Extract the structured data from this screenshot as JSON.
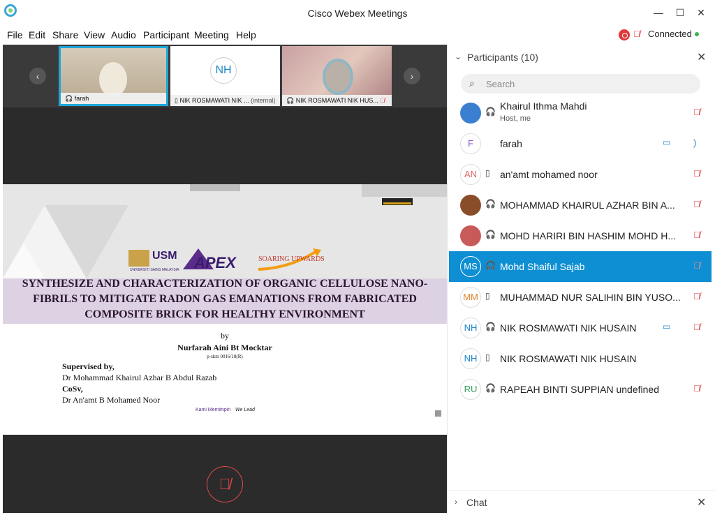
{
  "window": {
    "title": "Cisco Webex Meetings",
    "minimize": "—",
    "maximize": "☐",
    "close": "✕"
  },
  "menu": [
    "File",
    "Edit",
    "Share",
    "View",
    "Audio",
    "Participant",
    "Meeting",
    "Help"
  ],
  "status": {
    "connected": "Connected",
    "recording_icon": "record-icon"
  },
  "filmstrip": {
    "prev": "‹",
    "next": "›",
    "tiles": [
      {
        "label": "farah"
      },
      {
        "initials": "NH",
        "label": "NIK ROSMAWATI NIK ...",
        "suffix": "(internal)"
      },
      {
        "label": "NIK ROSMAWATI NIK HUS..."
      }
    ]
  },
  "slide": {
    "title_line1": "SYNTHESIZE AND CHARACTERIZATION OF ORGANIC CELLULOSE NANO-",
    "title_line2": "FIBRILS TO MITIGATE RADON GAS EMANATIONS FROM FABRICATED",
    "title_line3": "COMPOSITE BRICK FOR HEALTHY ENVIRONMENT",
    "by": "by",
    "author": "Nurfarah Aini Bt Mocktar",
    "id": "p-skm 0016/18(R)",
    "supervised": "Supervised by,",
    "supervisor": "Dr Mohammad Khairul Azhar B Abdul Razab",
    "cosv": "CoSv,",
    "cosupervisor": "Dr An'amt B Mohamed Noor",
    "tagline1": "Kami Memimpin",
    "tagline2": "We Lead",
    "logo_usm": "USM",
    "logo_usm_sub": "UNIVERSITI SAINS MALAYSIA",
    "logo_apex": "APEX",
    "logo_soaring": "SOARING UPWARDS"
  },
  "panel": {
    "header": "Participants (10)",
    "search_placeholder": "Search",
    "participants": [
      {
        "name": "Khairul Ithma Mahdi",
        "sub": "Host, me",
        "initials": "",
        "photo": true,
        "muted": true,
        "cam": false
      },
      {
        "name": "farah",
        "initials": "F",
        "muted": false,
        "cam": true
      },
      {
        "name": "an'amt mohamed noor",
        "initials": "AN",
        "muted": true,
        "cam": false
      },
      {
        "name": "MOHAMMAD KHAIRUL AZHAR BIN A...",
        "initials": "",
        "photo": true,
        "muted": true,
        "cam": false
      },
      {
        "name": "MOHD HARIRI BIN HASHIM MOHD H...",
        "initials": "",
        "photo": true,
        "muted": true,
        "cam": false
      },
      {
        "name": "Mohd Shaiful Sajab",
        "initials": "MS",
        "muted": true,
        "cam": false,
        "selected": true
      },
      {
        "name": "MUHAMMAD NUR SALIHIN BIN YUSO...",
        "initials": "MM",
        "muted": true,
        "cam": false
      },
      {
        "name": "NIK ROSMAWATI NIK HUSAIN",
        "initials": "NH",
        "muted": true,
        "cam": true
      },
      {
        "name": "NIK ROSMAWATI NIK HUSAIN",
        "initials": "NH",
        "muted": false,
        "cam": false
      },
      {
        "name": "RAPEAH BINTI SUPPIAN undefined",
        "initials": "RU",
        "muted": true,
        "cam": false
      }
    ],
    "chat_label": "Chat"
  },
  "colors": {
    "accent": "#0f8fd3",
    "muted": "#dd3333",
    "slide_band": "#ddd2e3"
  }
}
